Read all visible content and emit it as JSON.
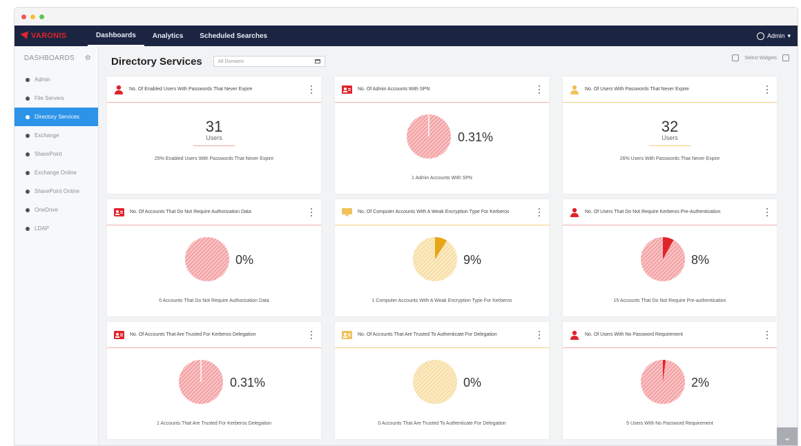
{
  "window": {
    "title": ""
  },
  "brand": {
    "logo": "VARONIS"
  },
  "nav": {
    "tabs": [
      "Dashboards",
      "Analytics",
      "Scheduled Searches"
    ],
    "user": "Admin"
  },
  "sidebar": {
    "heading": "DASHBOARDS",
    "items": [
      {
        "label": "Admin",
        "active": false
      },
      {
        "label": "File Servers",
        "active": false
      },
      {
        "label": "Directory Services",
        "active": true
      },
      {
        "label": "Exchange",
        "active": false
      },
      {
        "label": "SharePoint",
        "active": false
      },
      {
        "label": "Exchange Online",
        "active": false
      },
      {
        "label": "SharePoint Online",
        "active": false
      },
      {
        "label": "OneDrive",
        "active": false
      },
      {
        "label": "LDAP",
        "active": false
      }
    ]
  },
  "main": {
    "title": "Directory Services",
    "domain_select": "All Domains",
    "select_widgets": "Select Widgets"
  },
  "colors": {
    "red": "#e0242c",
    "pink": "#f4a3a5",
    "yellow": "#f0c15a",
    "sidebar_active": "#2c93e8",
    "navbar": "#1b2542"
  },
  "cards": [
    {
      "title": "No. Of Enabled Users With Passwords That Never Expire",
      "icon": "user-icon",
      "accent": "red",
      "kind": "number",
      "value": "31",
      "unit": "Users",
      "caption": "25% Enabled Users With Passwords That Never Expire"
    },
    {
      "title": "No. Of Admin Accounts With SPN",
      "icon": "id-card-icon",
      "accent": "red",
      "kind": "pie",
      "percent": "0.31%",
      "fraction": 0.0031,
      "caption": "1 Admin Accounts With SPN"
    },
    {
      "title": "No. Of Users With Passwords That Never Expire",
      "icon": "user-icon",
      "accent": "yellow",
      "kind": "number",
      "value": "32",
      "unit": "Users",
      "caption": "26% Users With Passwords That Never Expire"
    },
    {
      "title": "No. Of Accounts That Do Not Require Authorization Data",
      "icon": "id-card-icon",
      "accent": "red",
      "kind": "pie",
      "percent": "0%",
      "fraction": 0,
      "caption": "0 Accounts That Do Not Require Authorization Data"
    },
    {
      "title": "No. Of Computer Accounts With A Weak Encryption Type For Kerberos",
      "icon": "computer-icon",
      "accent": "yellow",
      "kind": "pie",
      "percent": "9%",
      "fraction": 0.09,
      "caption": "1 Computer Accounts With A Weak Encryption Type For Kerberos"
    },
    {
      "title": "No. Of Users That Do Not Require Kerberos Pre-Authentication",
      "icon": "user-icon",
      "accent": "red",
      "kind": "pie",
      "percent": "8%",
      "fraction": 0.08,
      "caption": "15 Accounts That Do Not Require Pre-authentication"
    },
    {
      "title": "No. Of Accounts That Are Trusted For Kerberos Delegation",
      "icon": "id-card-icon",
      "accent": "red",
      "kind": "pie",
      "percent": "0.31%",
      "fraction": 0.0031,
      "caption": "1 Accounts That Are Trusted For Kerberos Delegation"
    },
    {
      "title": "No. Of Accounts That Are Trusted To Authenticate For Delegation",
      "icon": "id-card-icon",
      "accent": "yellow",
      "kind": "pie",
      "percent": "0%",
      "fraction": 0,
      "caption": "0 Accounts That Are Trusted To Authenticate For Delegation"
    },
    {
      "title": "No. Of Users With No Password Requirement",
      "icon": "user-icon",
      "accent": "red",
      "kind": "pie",
      "percent": "2%",
      "fraction": 0.02,
      "caption": "5 Users With No Password Requirement"
    }
  ]
}
